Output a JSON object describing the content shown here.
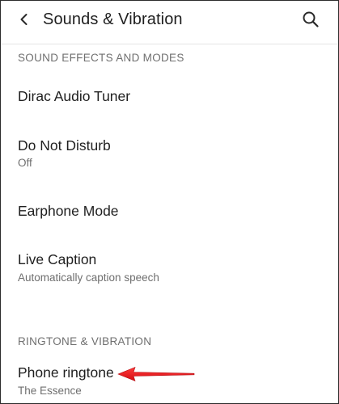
{
  "header": {
    "title": "Sounds & Vibration",
    "back_icon": "back-chevron-icon",
    "search_icon": "search-icon"
  },
  "sections": {
    "sound_effects": "SOUND EFFECTS AND MODES",
    "ringtone": "RINGTONE & VIBRATION"
  },
  "items": [
    {
      "title": "Dirac Audio Tuner",
      "subtitle": ""
    },
    {
      "title": "Do Not Disturb",
      "subtitle": "Off"
    },
    {
      "title": "Earphone Mode",
      "subtitle": ""
    },
    {
      "title": "Live Caption",
      "subtitle": "Automatically caption speech"
    },
    {
      "title": "Phone ringtone",
      "subtitle": "The Essence"
    }
  ],
  "annotation": {
    "arrow_color": "#e8161c",
    "arrow_icon": "red-arrow-pointer-icon"
  },
  "colors": {
    "text_primary": "#1f1f1f",
    "text_secondary": "#6f6f6f"
  }
}
